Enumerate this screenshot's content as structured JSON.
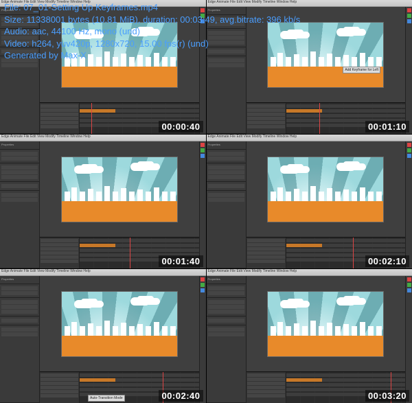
{
  "header": {
    "line1_label": "File:",
    "line1_value": "07_01-Setting Up Keyframes.mp4",
    "line2": "Size: 11338001 bytes (10.81 MiB), duration: 00:03:49, avg.bitrate: 396 kb/s",
    "line3": "Audio: aac, 44100 Hz, mono (und)",
    "line4": "Video: h264, yuv420p, 1280x720, 15.00 fps(r) (und)",
    "line5": "Generated by Max-X"
  },
  "menubar": "Edge Animate   File  Edit  View  Modify  Timeline  Window  Help",
  "thumbnails": [
    {
      "timestamp": "00:00:40",
      "playhead_pct": 10,
      "tooltip": null
    },
    {
      "timestamp": "00:01:10",
      "playhead_pct": 28,
      "tooltip": "Add Keyframe for Left",
      "tooltip_class": "tooltip-stage-1"
    },
    {
      "timestamp": "00:01:40",
      "playhead_pct": 42,
      "tooltip": null
    },
    {
      "timestamp": "00:02:10",
      "playhead_pct": 56,
      "tooltip": null
    },
    {
      "timestamp": "00:02:40",
      "playhead_pct": 70,
      "tooltip": "Auto-Transition Mode",
      "tooltip_class": "tooltip-tl-5"
    },
    {
      "timestamp": "00:03:20",
      "playhead_pct": 88,
      "tooltip": null
    }
  ],
  "panels": {
    "properties": "Properties",
    "stage": "Stage"
  }
}
